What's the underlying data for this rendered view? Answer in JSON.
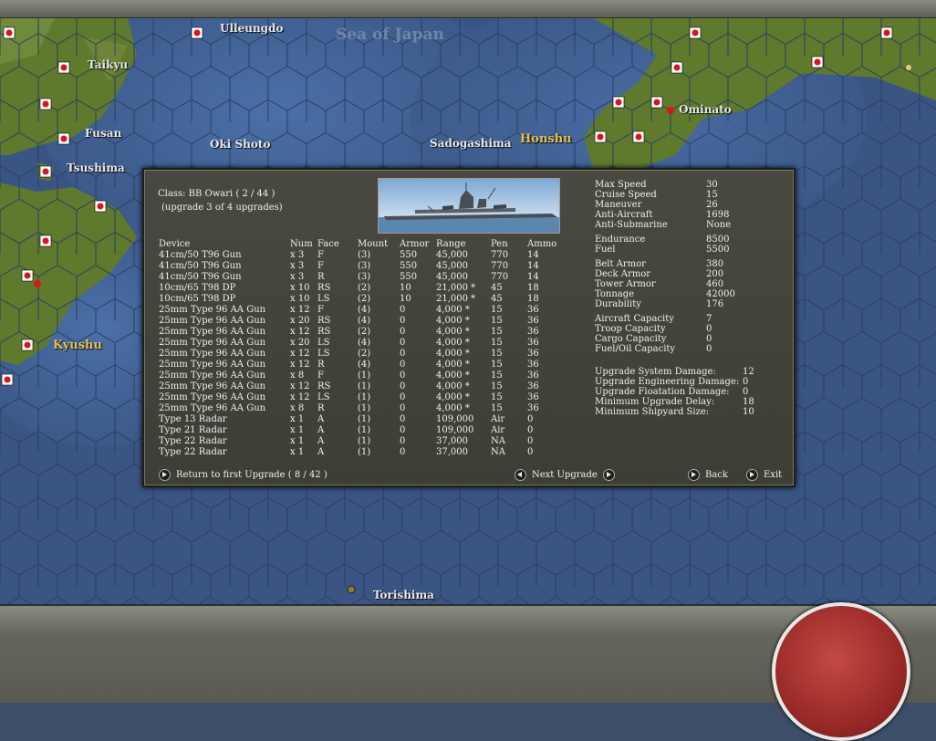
{
  "map": {
    "labels": {
      "ulleungdo": "Ulleungdo",
      "sea_of_japan": "Sea of Japan",
      "taikyu": "Taikyu",
      "fusan": "Fusan",
      "oki_shoto": "Oki Shoto",
      "sadogashima": "Sadogashima",
      "honshu": "Honshu",
      "ominato": "Ominato",
      "tsushima": "Tsushima",
      "kyushu": "Kyushu",
      "torishima": "Torishima"
    }
  },
  "ship": {
    "class_line": "Class: BB Owari ( 2 / 44 )",
    "upgrade_line": "(upgrade 3 of 4 upgrades)"
  },
  "table": {
    "headers": [
      "Device",
      "Num",
      "Face",
      "Mount",
      "Armor",
      "Range",
      "Pen",
      "Ammo"
    ],
    "rows": [
      [
        "41cm/50 T96 Gun",
        "x 3",
        "F",
        "(3)",
        "550",
        "45,000",
        "770",
        "14"
      ],
      [
        "41cm/50 T96 Gun",
        "x 3",
        "F",
        "(3)",
        "550",
        "45,000",
        "770",
        "14"
      ],
      [
        "41cm/50 T96 Gun",
        "x 3",
        "R",
        "(3)",
        "550",
        "45,000",
        "770",
        "14"
      ],
      [
        "10cm/65 T98 DP",
        "x 10",
        "RS",
        "(2)",
        "10",
        "21,000 *",
        "45",
        "18"
      ],
      [
        "10cm/65 T98 DP",
        "x 10",
        "LS",
        "(2)",
        "10",
        "21,000 *",
        "45",
        "18"
      ],
      [
        "25mm Type 96 AA Gun",
        "x 12",
        "F",
        "(4)",
        "0",
        "4,000 *",
        "15",
        "36"
      ],
      [
        "25mm Type 96 AA Gun",
        "x 20",
        "RS",
        "(4)",
        "0",
        "4,000 *",
        "15",
        "36"
      ],
      [
        "25mm Type 96 AA Gun",
        "x 12",
        "RS",
        "(2)",
        "0",
        "4,000 *",
        "15",
        "36"
      ],
      [
        "25mm Type 96 AA Gun",
        "x 20",
        "LS",
        "(4)",
        "0",
        "4,000 *",
        "15",
        "36"
      ],
      [
        "25mm Type 96 AA Gun",
        "x 12",
        "LS",
        "(2)",
        "0",
        "4,000 *",
        "15",
        "36"
      ],
      [
        "25mm Type 96 AA Gun",
        "x 12",
        "R",
        "(4)",
        "0",
        "4,000 *",
        "15",
        "36"
      ],
      [
        "25mm Type 96 AA Gun",
        "x 8",
        "F",
        "(1)",
        "0",
        "4,000 *",
        "15",
        "36"
      ],
      [
        "25mm Type 96 AA Gun",
        "x 12",
        "RS",
        "(1)",
        "0",
        "4,000 *",
        "15",
        "36"
      ],
      [
        "25mm Type 96 AA Gun",
        "x 12",
        "LS",
        "(1)",
        "0",
        "4,000 *",
        "15",
        "36"
      ],
      [
        "25mm Type 96 AA Gun",
        "x 8",
        "R",
        "(1)",
        "0",
        "4,000 *",
        "15",
        "36"
      ],
      [
        "Type 13 Radar",
        "x 1",
        "A",
        "(1)",
        "0",
        "109,000",
        "Air",
        "0"
      ],
      [
        "Type 21 Radar",
        "x 1",
        "A",
        "(1)",
        "0",
        "109,000",
        "Air",
        "0"
      ],
      [
        "Type 22 Radar",
        "x 1",
        "A",
        "(1)",
        "0",
        "37,000",
        "NA",
        "0"
      ],
      [
        "Type 22 Radar",
        "x 1",
        "A",
        "(1)",
        "0",
        "37,000",
        "NA",
        "0"
      ]
    ]
  },
  "stats": {
    "g1": [
      [
        "Max Speed",
        "30"
      ],
      [
        "Cruise Speed",
        "15"
      ],
      [
        "Maneuver",
        "26"
      ],
      [
        "Anti-Aircraft",
        "1698"
      ],
      [
        "Anti-Submarine",
        "None"
      ]
    ],
    "g2": [
      [
        "Endurance",
        "8500"
      ],
      [
        "Fuel",
        "5500"
      ]
    ],
    "g3": [
      [
        "Belt Armor",
        "380"
      ],
      [
        "Deck Armor",
        "200"
      ],
      [
        "Tower Armor",
        "460"
      ],
      [
        "Tonnage",
        "42000"
      ],
      [
        "Durability",
        "176"
      ]
    ],
    "g4": [
      [
        "Aircraft Capacity",
        "7"
      ],
      [
        "Troop Capacity",
        "0"
      ],
      [
        "Cargo Capacity",
        "0"
      ],
      [
        "Fuel/Oil Capacity",
        "0"
      ]
    ],
    "g5": [
      [
        "Upgrade System Damage:",
        "12"
      ],
      [
        "Upgrade Engineering Damage:",
        "0"
      ],
      [
        "Upgrade Floatation Damage:",
        "0"
      ],
      [
        "Minimum Upgrade Delay:",
        "18"
      ],
      [
        "Minimum Shipyard Size:",
        "10"
      ]
    ]
  },
  "buttons": {
    "return_first": "Return to first Upgrade ( 8 / 42 )",
    "next_upgrade": "Next Upgrade",
    "back": "Back",
    "exit": "Exit"
  },
  "colors": {
    "land": "#5f7a2c",
    "sea": "#3c5a8a",
    "panel": "#45453c",
    "unit_red": "#d8141c"
  }
}
